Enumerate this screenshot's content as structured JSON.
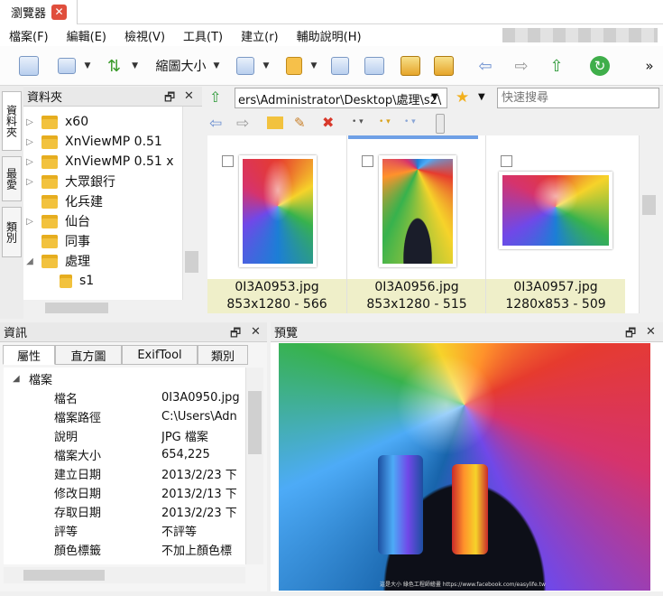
{
  "window": {
    "tab_title": "瀏覽器",
    "close_glyph": "✕"
  },
  "menu": [
    "檔案(F)",
    "編輯(E)",
    "檢視(V)",
    "工具(T)",
    "建立(r)",
    "輔助說明(H)"
  ],
  "toolbar": {
    "thumbsize_label": "縮圖大小",
    "more": "»"
  },
  "side_tabs": [
    "資料夾",
    "最愛",
    "類別"
  ],
  "folders_panel": {
    "title": "資料夾",
    "items": [
      {
        "label": "x60",
        "expandable": true
      },
      {
        "label": "XnViewMP 0.51",
        "expandable": true
      },
      {
        "label": "XnViewMP 0.51 x",
        "expandable": true
      },
      {
        "label": "大眾銀行",
        "expandable": true
      },
      {
        "label": "化兵建",
        "expandable": false
      },
      {
        "label": "仙台",
        "expandable": true
      },
      {
        "label": "同事",
        "expandable": false
      },
      {
        "label": "處理",
        "expandable": true,
        "expanded": true
      },
      {
        "label": "s1",
        "expandable": false
      }
    ]
  },
  "address": {
    "path": "ers\\Administrator\\Desktop\\處理\\s2\\",
    "search_placeholder": "快速搜尋"
  },
  "thumbnails": [
    {
      "name": "0I3A0953.jpg",
      "info": "853x1280 - 566"
    },
    {
      "name": "0I3A0956.jpg",
      "info": "853x1280 - 515"
    },
    {
      "name": "0I3A0957.jpg",
      "info": "1280x853 - 509"
    }
  ],
  "info_panel": {
    "title": "資訊",
    "tabs": [
      "屬性",
      "直方圖",
      "ExifTool",
      "類別"
    ],
    "group": "檔案",
    "rows": [
      {
        "key": "檔名",
        "value": "0I3A0950.jpg"
      },
      {
        "key": "檔案路徑",
        "value": "C:\\Users\\Adn"
      },
      {
        "key": "說明",
        "value": "JPG 檔案"
      },
      {
        "key": "檔案大小",
        "value": "654,225"
      },
      {
        "key": "建立日期",
        "value": "2013/2/23 下"
      },
      {
        "key": "修改日期",
        "value": "2013/2/13 下"
      },
      {
        "key": "存取日期",
        "value": "2013/2/23 下"
      },
      {
        "key": "評等",
        "value": "不評等"
      },
      {
        "key": "顏色標籤",
        "value": "不加上顏色標"
      }
    ]
  },
  "preview_panel": {
    "title": "預覽",
    "caption": "這是大小 綠色工程師繪畫 https://www.facebook.com/easylife.tw"
  },
  "panel_buttons": {
    "float": "🗗",
    "close": "✕"
  },
  "colors": {
    "accent": "#7a98c4",
    "thumb_footer": "#efefc9",
    "tab_close": "#e04e3c"
  }
}
